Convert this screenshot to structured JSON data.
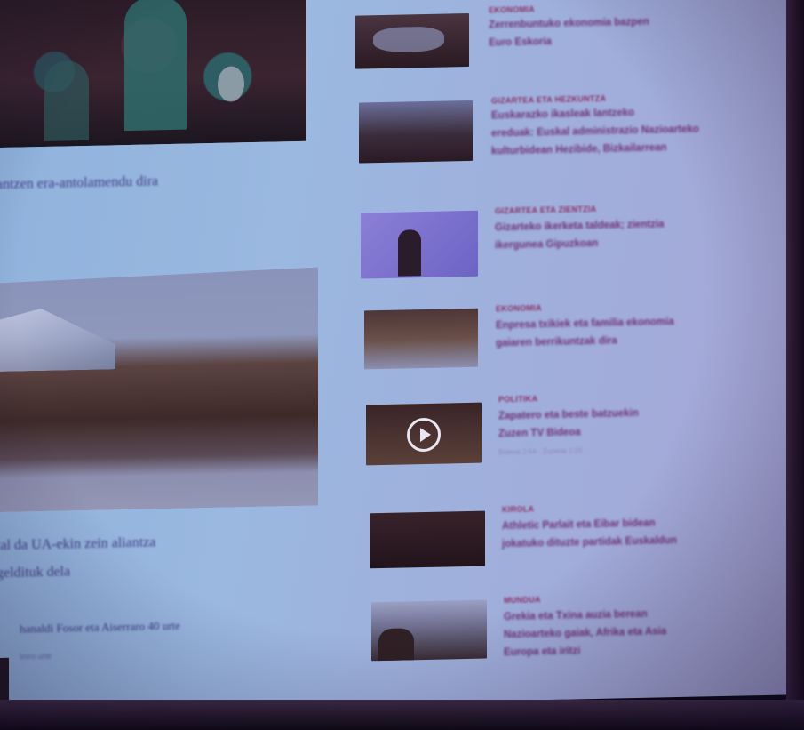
{
  "left_column": {
    "headline_1": "antzen era-antolamendu dira",
    "headline_2_line1": "tal da UA-ekin zein aliantza",
    "headline_2_line2": "geldituk dela",
    "small_headline": "hanaldi Fosor eta Aiserraro 40 urte",
    "small_meta": "Imro urte"
  },
  "right_list": [
    {
      "category": "EKONOMIA",
      "title_lines": [
        "Zerrenbuntuko ekonomia bazpen",
        "Euro Eskoria"
      ],
      "meta": ""
    },
    {
      "category": "GIZARTEA ETA HEZKUNTZA",
      "title_lines": [
        "Euskarazko ikasleak lantzeko",
        "ereduak: Euskal administrazio Nazioarteko",
        "kulturbidean Hezibide, Bizkailarrean"
      ],
      "meta": ""
    },
    {
      "category": "GIZARTEA ETA ZIENTZIA",
      "title_lines": [
        "Gizarteko ikerketa taldeak; zientzia",
        "ikergunea Gipuzkoan"
      ],
      "meta": ""
    },
    {
      "category": "EKONOMIA",
      "title_lines": [
        "Enpresa txikiek eta familia ekonomia",
        "gaiaren berrikuntzak dira"
      ],
      "meta": ""
    },
    {
      "category": "POLITIKA",
      "title_lines": [
        "Zapatero eta beste batzuekin",
        "Zuzen TV Bideoa"
      ],
      "meta": "Bideoa 2:54 · Zuzena 1:15"
    },
    {
      "category": "KIROLA",
      "title_lines": [
        "Athletic Parlait eta Eibar bidean",
        "jokatuko dituzte partidak Euskaldun"
      ],
      "meta": ""
    },
    {
      "category": "MUNDUA",
      "title_lines": [
        "Grekia eta Txina auzia berean",
        "Nazioarteko gaiak, Afrika eta Asia",
        "Europa eta iritzi"
      ],
      "meta": ""
    }
  ],
  "colors": {
    "screen_bg": "#9ab8e0",
    "title": "#6e2f74",
    "category": "#8a2d63",
    "left_text": "#3f3d86"
  }
}
